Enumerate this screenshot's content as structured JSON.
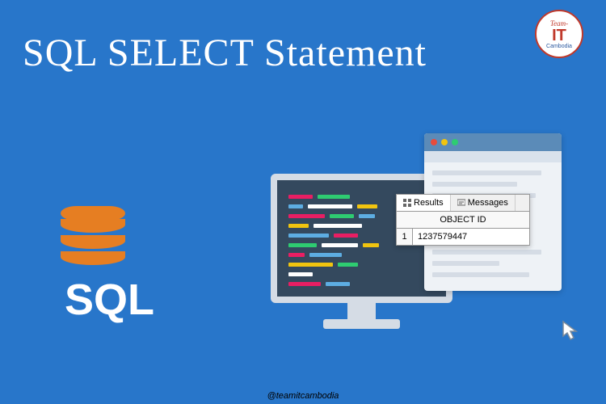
{
  "title": "SQL SELECT Statement",
  "logo": {
    "top": "Team-",
    "main": "IT",
    "bottom": "Cambodia"
  },
  "sql_label": "SQL",
  "results": {
    "tab_results": "Results",
    "tab_messages": "Messages",
    "column": "OBJECT ID",
    "row_num": "1",
    "value": "1237579447"
  },
  "footer": "@teamitcambodia",
  "colors": {
    "bg": "#2876ca",
    "orange": "#e67e22",
    "red_dot": "#e74c3c",
    "yellow_dot": "#f1c40f",
    "green_dot": "#2ecc71"
  }
}
